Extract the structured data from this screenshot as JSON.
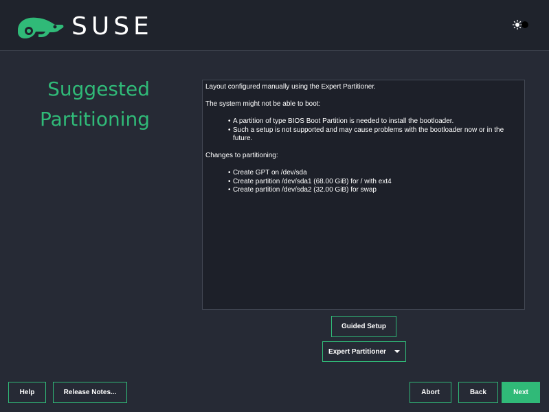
{
  "app": {
    "brand": "SUSE",
    "brand_color": "#30ba78"
  },
  "header": {
    "logo_icon": "chameleon-icon",
    "theme_toggle_icon": "theme-toggle-icon"
  },
  "page": {
    "title_line1": "Suggested",
    "title_line2": "Partitioning"
  },
  "summary": {
    "intro": "Layout configured manually using the Expert Partitioner.",
    "warning_heading": "The system might not be able to boot:",
    "warnings": [
      "A partition of type BIOS Boot Partition is needed to install the bootloader.",
      "Such a setup is not supported and may cause problems with the bootloader now or in the future."
    ],
    "changes_heading": "Changes to partitioning:",
    "changes": [
      "Create GPT on /dev/sda",
      "Create partition /dev/sda1 (68.00 GiB) for / with ext4",
      "Create partition /dev/sda2 (32.00 GiB) for swap"
    ]
  },
  "actions": {
    "guided_setup": "Guided Setup",
    "expert_partitioner": "Expert Partitioner"
  },
  "footer": {
    "help": "Help",
    "release_notes": "Release Notes...",
    "abort": "Abort",
    "back": "Back",
    "next": "Next"
  }
}
